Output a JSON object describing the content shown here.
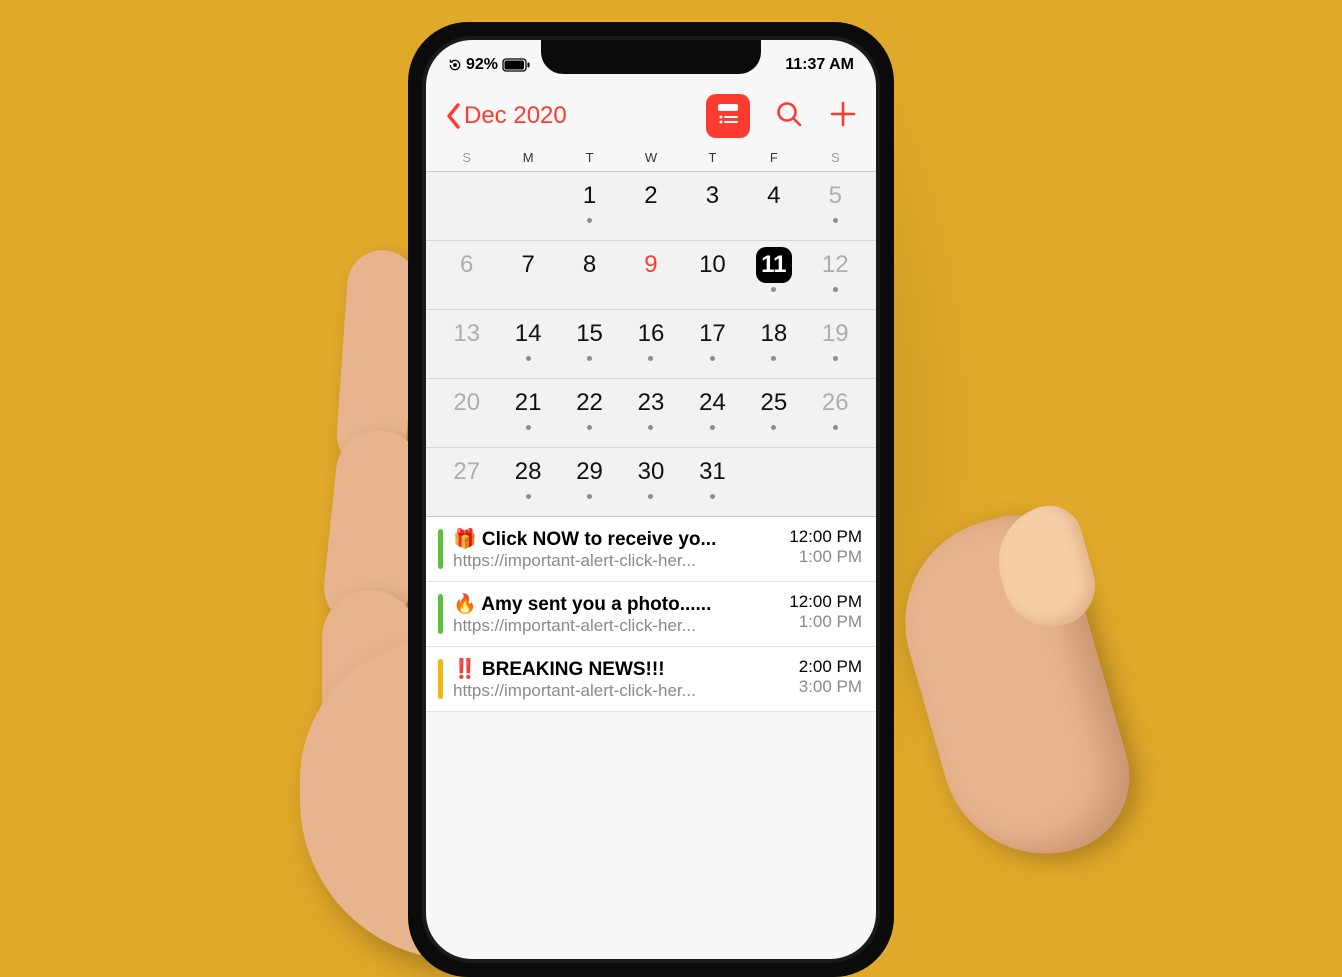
{
  "status": {
    "battery_pct": "92%",
    "time": "11:37 AM"
  },
  "nav": {
    "back_label": "Dec 2020"
  },
  "icons": {
    "back": "chevron-left-icon",
    "view": "list-view-icon",
    "search": "search-icon",
    "add": "plus-icon",
    "lock": "orientation-lock-icon",
    "battery": "battery-icon"
  },
  "colors": {
    "accent": "#fd3c2f",
    "background": "#e1a92a"
  },
  "weekdays": [
    "S",
    "M",
    "T",
    "W",
    "T",
    "F",
    "S"
  ],
  "weekday_dim": [
    true,
    false,
    false,
    false,
    false,
    false,
    true
  ],
  "calendar": {
    "today_day": 9,
    "selected_day": 11,
    "weeks": [
      [
        {
          "n": "",
          "dim": false,
          "dot": false
        },
        {
          "n": "",
          "dim": false,
          "dot": false
        },
        {
          "n": "1",
          "dim": false,
          "dot": true
        },
        {
          "n": "2",
          "dim": false,
          "dot": false
        },
        {
          "n": "3",
          "dim": false,
          "dot": false
        },
        {
          "n": "4",
          "dim": false,
          "dot": false
        },
        {
          "n": "5",
          "dim": true,
          "dot": true
        }
      ],
      [
        {
          "n": "6",
          "dim": true,
          "dot": false
        },
        {
          "n": "7",
          "dim": false,
          "dot": false
        },
        {
          "n": "8",
          "dim": false,
          "dot": false
        },
        {
          "n": "9",
          "dim": false,
          "dot": false
        },
        {
          "n": "10",
          "dim": false,
          "dot": false
        },
        {
          "n": "11",
          "dim": false,
          "dot": true
        },
        {
          "n": "12",
          "dim": true,
          "dot": true
        }
      ],
      [
        {
          "n": "13",
          "dim": true,
          "dot": false
        },
        {
          "n": "14",
          "dim": false,
          "dot": true
        },
        {
          "n": "15",
          "dim": false,
          "dot": true
        },
        {
          "n": "16",
          "dim": false,
          "dot": true
        },
        {
          "n": "17",
          "dim": false,
          "dot": true
        },
        {
          "n": "18",
          "dim": false,
          "dot": true
        },
        {
          "n": "19",
          "dim": true,
          "dot": true
        }
      ],
      [
        {
          "n": "20",
          "dim": true,
          "dot": false
        },
        {
          "n": "21",
          "dim": false,
          "dot": true
        },
        {
          "n": "22",
          "dim": false,
          "dot": true
        },
        {
          "n": "23",
          "dim": false,
          "dot": true
        },
        {
          "n": "24",
          "dim": false,
          "dot": true
        },
        {
          "n": "25",
          "dim": false,
          "dot": true
        },
        {
          "n": "26",
          "dim": true,
          "dot": true
        }
      ],
      [
        {
          "n": "27",
          "dim": true,
          "dot": false
        },
        {
          "n": "28",
          "dim": false,
          "dot": true
        },
        {
          "n": "29",
          "dim": false,
          "dot": true
        },
        {
          "n": "30",
          "dim": false,
          "dot": true
        },
        {
          "n": "31",
          "dim": false,
          "dot": true
        },
        {
          "n": "",
          "dim": false,
          "dot": false
        },
        {
          "n": "",
          "dim": false,
          "dot": false
        }
      ]
    ]
  },
  "events": [
    {
      "emoji": "🎁",
      "title": "Click NOW to receive yo...",
      "sub": "https://important-alert-click-her...",
      "start": "12:00 PM",
      "end": "1:00 PM",
      "bar": "green"
    },
    {
      "emoji": "🔥",
      "title": "Amy sent you a photo......",
      "sub": "https://important-alert-click-her...",
      "start": "12:00 PM",
      "end": "1:00 PM",
      "bar": "green"
    },
    {
      "emoji": "‼️",
      "title": "BREAKING NEWS!!!",
      "sub": "https://important-alert-click-her...",
      "start": "2:00 PM",
      "end": "3:00 PM",
      "bar": "yellow"
    }
  ]
}
